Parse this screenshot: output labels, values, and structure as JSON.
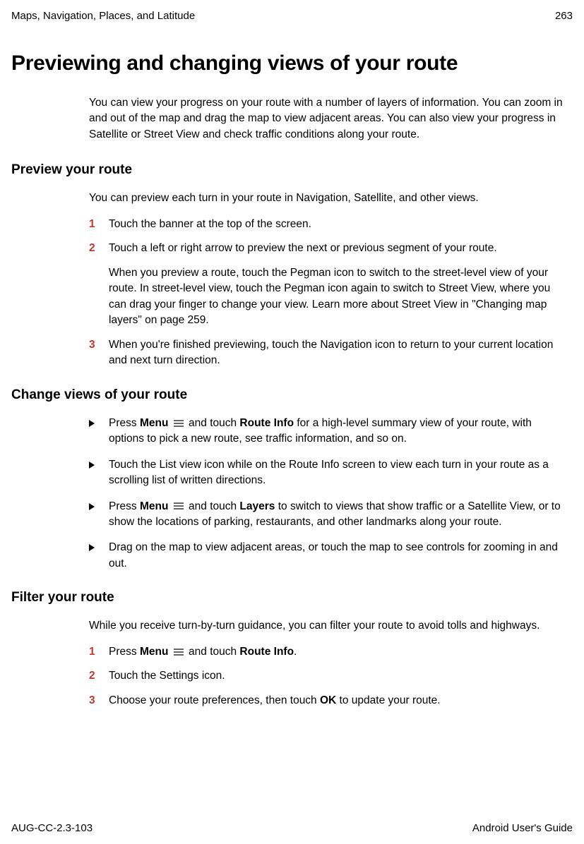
{
  "header": {
    "chapter": "Maps, Navigation, Places, and Latitude",
    "page_number": "263"
  },
  "title": "Previewing and changing views of your route",
  "intro": "You can view your progress on your route with a number of layers of information. You can zoom in and out of the map and drag the map to view adjacent areas. You can also view your progress in Satellite or Street View and check traffic conditions along your route.",
  "sections": {
    "preview": {
      "heading": "Preview your route",
      "intro": "You can preview each turn in your route in Navigation, Satellite, and other views.",
      "steps": {
        "1": "Touch the banner at the top of the screen.",
        "2": "Touch a left or right arrow to preview the next or previous segment of your route.",
        "2_sub": "When you preview a route, touch the Pegman icon to switch to the street-level view of your route. In street-level view, touch the Pegman icon again to switch to Street View, where you can drag your finger to change your view. Learn more about Street View in \"Changing map layers\" on page 259.",
        "3": "When you're finished previewing, touch the Navigation icon to return to your current location and next turn direction."
      }
    },
    "change": {
      "heading": "Change views of your route",
      "bullets": {
        "b1_pre": "Press ",
        "b1_menu": "Menu",
        "b1_mid": " and touch ",
        "b1_bold": "Route Info",
        "b1_post": " for a high-level summary view of your route, with options to pick a new route, see traffic information, and so on.",
        "b2": "Touch the List view icon while on the Route Info screen to view each turn in your route as a scrolling list of written directions.",
        "b3_pre": "Press ",
        "b3_menu": "Menu",
        "b3_mid": " and touch ",
        "b3_bold": "Layers",
        "b3_post": " to switch to views that show traffic or a Satellite View, or to show the locations of parking, restaurants, and other landmarks along your route.",
        "b4": "Drag on the map to view adjacent areas, or touch the map to see controls for zooming in and out."
      }
    },
    "filter": {
      "heading": "Filter your route",
      "intro": "While you receive turn-by-turn guidance, you can filter your route to avoid tolls and highways.",
      "steps": {
        "s1_pre": "Press ",
        "s1_menu": "Menu",
        "s1_mid": " and touch ",
        "s1_bold": "Route Info",
        "s1_post": ".",
        "s2": "Touch the Settings icon.",
        "s3_pre": "Choose your route preferences, then touch ",
        "s3_bold": "OK",
        "s3_post": " to update your route."
      }
    }
  },
  "numbers": {
    "n1": "1",
    "n2": "2",
    "n3": "3"
  },
  "footer": {
    "doc_id": "AUG-CC-2.3-103",
    "guide_name": "Android User's Guide"
  }
}
